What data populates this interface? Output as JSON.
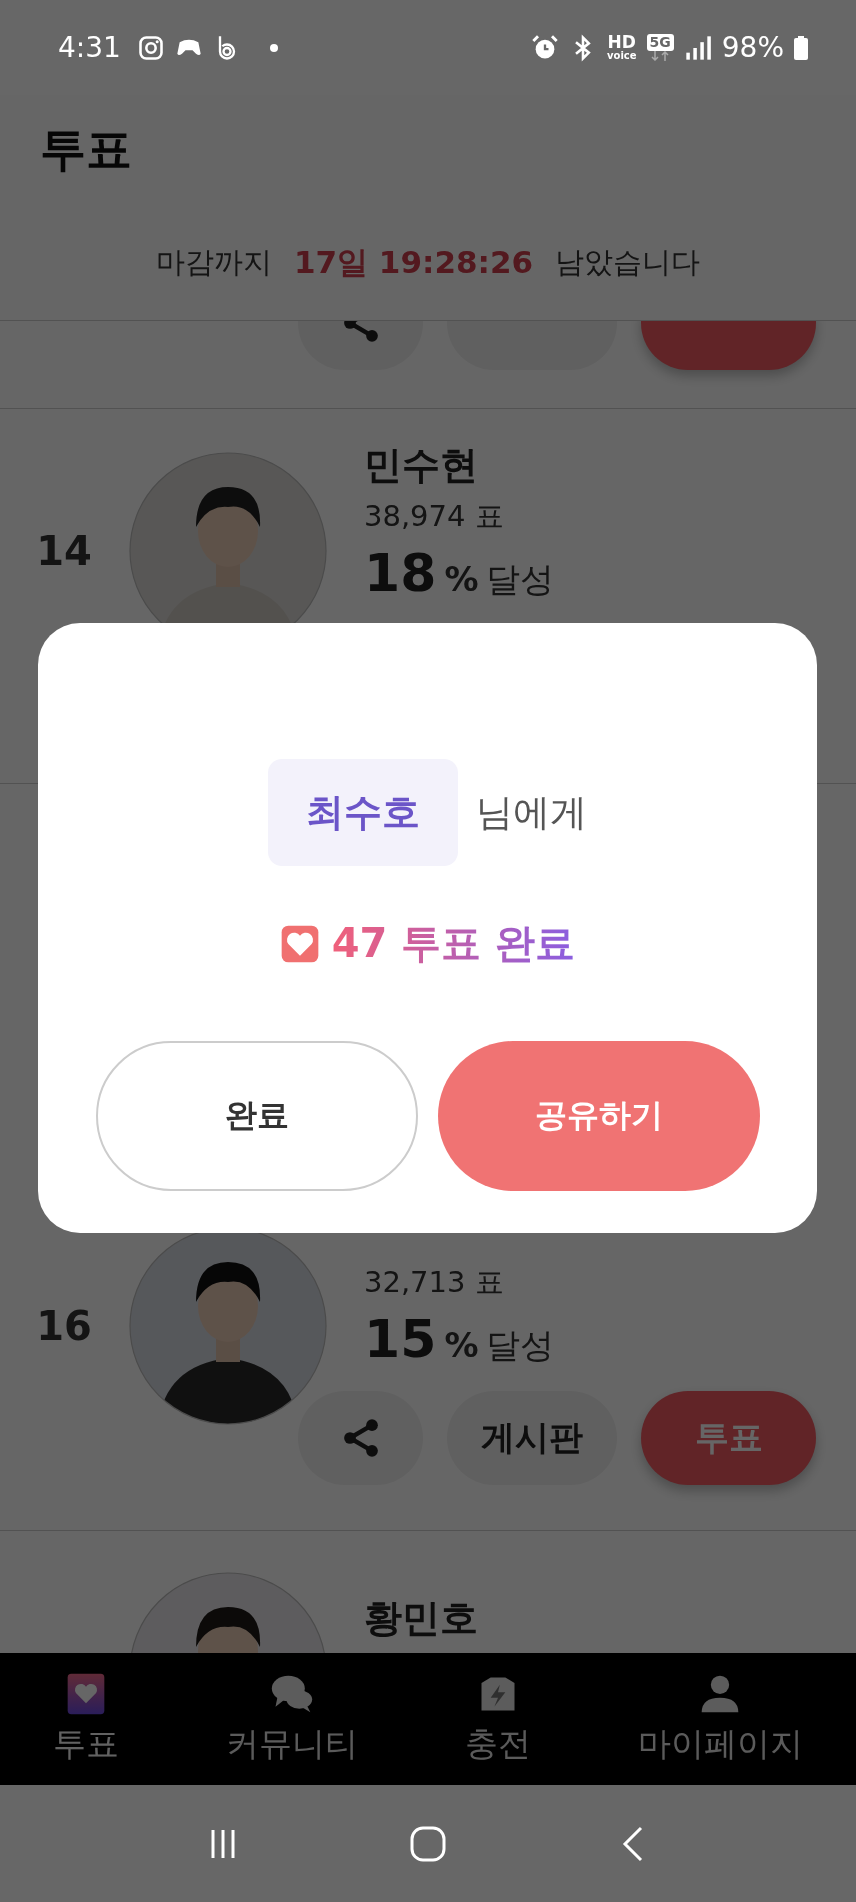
{
  "status_bar": {
    "time": "4:31",
    "hd": "HD",
    "voice": "voice",
    "network": "5G",
    "battery": "98%"
  },
  "header": {
    "title": "투표",
    "countdown": {
      "prefix": "마감까지",
      "remaining": "17일 19:28:26",
      "suffix": "남았습니다"
    }
  },
  "candidates": [
    {
      "kind": "actions"
    },
    {
      "rank": "14",
      "name": "민수현",
      "votes": "38,974 표",
      "percent": "18",
      "percent_sign": "%",
      "achieved": "달성"
    },
    {
      "rank": "16",
      "votes": "32,713 표",
      "percent": "15",
      "percent_sign": "%",
      "achieved": "달성",
      "actions": {
        "board": "게시판",
        "vote": "투표"
      }
    },
    {
      "name": "황민호"
    }
  ],
  "dialog": {
    "recipient": "최수호",
    "recipient_suffix": "님에게",
    "result": "47 투표 완료",
    "buttons": [
      {
        "label": "완료",
        "kind": "outline"
      },
      {
        "label": "공유하기",
        "kind": "primary"
      }
    ]
  },
  "bottom_nav": [
    {
      "label": "투표",
      "selected": true
    },
    {
      "label": "커뮤니티",
      "selected": false
    },
    {
      "label": "충전",
      "selected": false
    },
    {
      "label": "마이페이지",
      "selected": false
    }
  ]
}
